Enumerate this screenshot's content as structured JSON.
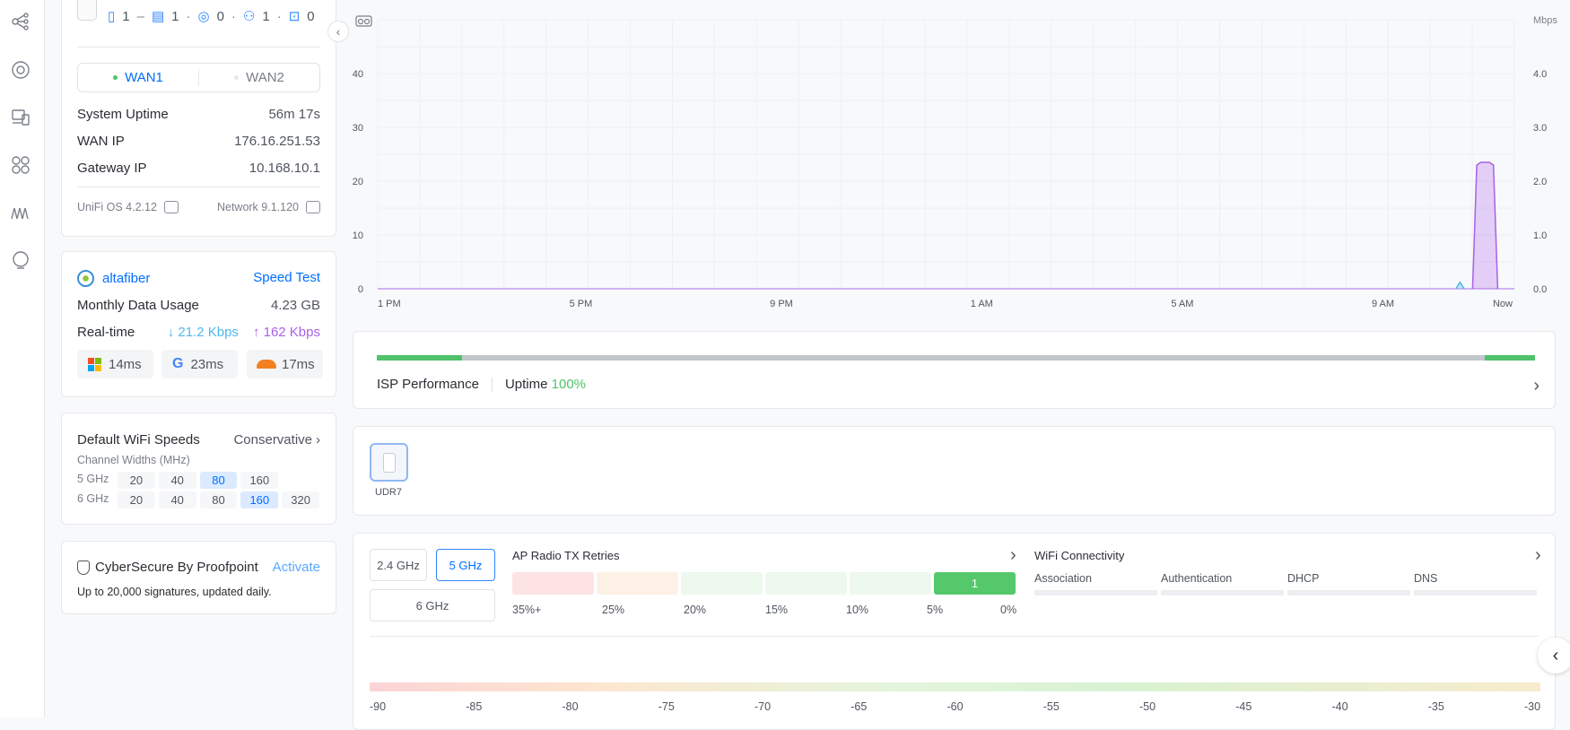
{
  "device_counts": [
    "1",
    "1",
    "0",
    "1",
    "0"
  ],
  "wan_tabs": [
    "WAN1",
    "WAN2"
  ],
  "system": {
    "uptime_label": "System Uptime",
    "uptime": "56m 17s",
    "wan_ip_label": "WAN IP",
    "wan_ip": "176.16.251.53",
    "gateway_label": "Gateway IP",
    "gateway": "10.168.10.1",
    "os_version": "UniFi OS 4.2.12",
    "network_version": "Network 9.1.120"
  },
  "isp": {
    "name": "altafiber",
    "speed_test": "Speed Test",
    "monthly_label": "Monthly Data Usage",
    "monthly": "4.23 GB",
    "realtime_label": "Real-time",
    "down": "21.2 Kbps",
    "up": "162 Kbps",
    "pings": [
      "14ms",
      "23ms",
      "17ms"
    ]
  },
  "wifi_speeds": {
    "title": "Default WiFi Speeds",
    "mode": "Conservative",
    "subtitle": "Channel Widths (MHz)",
    "band5": "5 GHz",
    "band5_options": [
      "20",
      "40",
      "80",
      "160"
    ],
    "band5_selected": "80",
    "band6": "6 GHz",
    "band6_options": [
      "20",
      "40",
      "80",
      "160",
      "320"
    ],
    "band6_selected": "160"
  },
  "cybersecure": {
    "title": "CyberSecure By Proofpoint",
    "action": "Activate",
    "desc": "Up to 20,000 signatures, updated daily."
  },
  "chart_data": {
    "type": "line",
    "x_ticks": [
      "1 PM",
      "5 PM",
      "9 PM",
      "1 AM",
      "5 AM",
      "9 AM",
      "Now"
    ],
    "y_left_ticks": [
      "0",
      "10",
      "20",
      "30",
      "40"
    ],
    "y_right_ticks": [
      "0.0",
      "1.0",
      "2.0",
      "3.0",
      "4.0"
    ],
    "y_right_label": "Mbps",
    "ylim_left": [
      0,
      50
    ],
    "ylim_right": [
      0,
      5.0
    ],
    "grid": true,
    "series": [
      {
        "color": "#a861e8",
        "axis": "right",
        "x": [
          "10:50 AM",
          "10:55 AM",
          "11:00 AM",
          "11:10 AM",
          "11:15 AM",
          "11:20 AM"
        ],
        "values": [
          0.0,
          2.3,
          2.35,
          2.35,
          2.3,
          0.0
        ]
      },
      {
        "color": "#4fb6ee",
        "axis": "right",
        "x": [
          "10:30 AM",
          "10:35 AM",
          "10:40 AM"
        ],
        "values": [
          0.0,
          0.12,
          0.0
        ]
      }
    ]
  },
  "isp_performance": {
    "label": "ISP Performance",
    "uptime_label": "Uptime",
    "uptime": "100%"
  },
  "device": {
    "name": "UDR7"
  },
  "radio": {
    "bands": [
      "2.4 GHz",
      "5 GHz",
      "6 GHz"
    ],
    "selected": "5 GHz",
    "tx_title": "AP Radio TX Retries",
    "tx_buckets": [
      "35%+",
      "25%",
      "20%",
      "15%",
      "10%",
      "5%",
      "0%"
    ],
    "tx_count": "1",
    "wifi_title": "WiFi Connectivity",
    "wifi_cols": [
      "Association",
      "Authentication",
      "DHCP",
      "DNS"
    ]
  },
  "signal_scale": [
    "-90",
    "-85",
    "-80",
    "-75",
    "-70",
    "-65",
    "-60",
    "-55",
    "-50",
    "-45",
    "-40",
    "-35",
    "-30"
  ],
  "colors": {
    "accent": "#006fff",
    "good": "#4fc26a",
    "purple": "#a861e8",
    "cyan": "#4fb6ee"
  }
}
